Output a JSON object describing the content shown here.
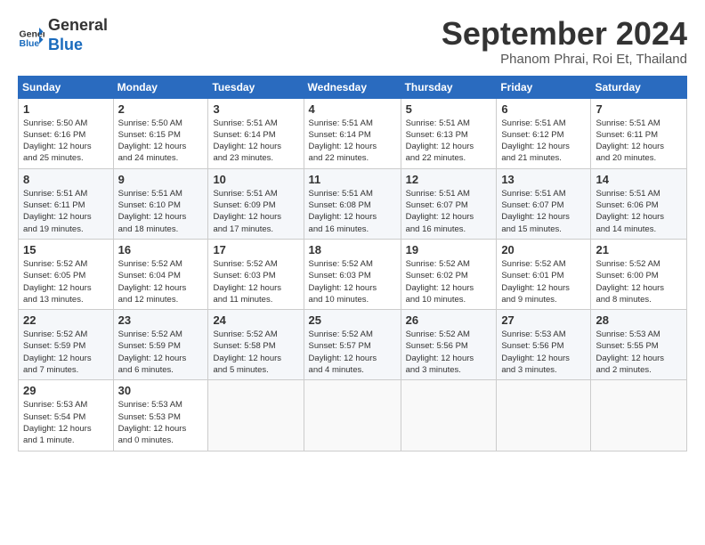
{
  "header": {
    "logo_line1": "General",
    "logo_line2": "Blue",
    "month_title": "September 2024",
    "location": "Phanom Phrai, Roi Et, Thailand"
  },
  "weekdays": [
    "Sunday",
    "Monday",
    "Tuesday",
    "Wednesday",
    "Thursday",
    "Friday",
    "Saturday"
  ],
  "weeks": [
    [
      {
        "day": "1",
        "info": "Sunrise: 5:50 AM\nSunset: 6:16 PM\nDaylight: 12 hours\nand 25 minutes."
      },
      {
        "day": "2",
        "info": "Sunrise: 5:50 AM\nSunset: 6:15 PM\nDaylight: 12 hours\nand 24 minutes."
      },
      {
        "day": "3",
        "info": "Sunrise: 5:51 AM\nSunset: 6:14 PM\nDaylight: 12 hours\nand 23 minutes."
      },
      {
        "day": "4",
        "info": "Sunrise: 5:51 AM\nSunset: 6:14 PM\nDaylight: 12 hours\nand 22 minutes."
      },
      {
        "day": "5",
        "info": "Sunrise: 5:51 AM\nSunset: 6:13 PM\nDaylight: 12 hours\nand 22 minutes."
      },
      {
        "day": "6",
        "info": "Sunrise: 5:51 AM\nSunset: 6:12 PM\nDaylight: 12 hours\nand 21 minutes."
      },
      {
        "day": "7",
        "info": "Sunrise: 5:51 AM\nSunset: 6:11 PM\nDaylight: 12 hours\nand 20 minutes."
      }
    ],
    [
      {
        "day": "8",
        "info": "Sunrise: 5:51 AM\nSunset: 6:11 PM\nDaylight: 12 hours\nand 19 minutes."
      },
      {
        "day": "9",
        "info": "Sunrise: 5:51 AM\nSunset: 6:10 PM\nDaylight: 12 hours\nand 18 minutes."
      },
      {
        "day": "10",
        "info": "Sunrise: 5:51 AM\nSunset: 6:09 PM\nDaylight: 12 hours\nand 17 minutes."
      },
      {
        "day": "11",
        "info": "Sunrise: 5:51 AM\nSunset: 6:08 PM\nDaylight: 12 hours\nand 16 minutes."
      },
      {
        "day": "12",
        "info": "Sunrise: 5:51 AM\nSunset: 6:07 PM\nDaylight: 12 hours\nand 16 minutes."
      },
      {
        "day": "13",
        "info": "Sunrise: 5:51 AM\nSunset: 6:07 PM\nDaylight: 12 hours\nand 15 minutes."
      },
      {
        "day": "14",
        "info": "Sunrise: 5:51 AM\nSunset: 6:06 PM\nDaylight: 12 hours\nand 14 minutes."
      }
    ],
    [
      {
        "day": "15",
        "info": "Sunrise: 5:52 AM\nSunset: 6:05 PM\nDaylight: 12 hours\nand 13 minutes."
      },
      {
        "day": "16",
        "info": "Sunrise: 5:52 AM\nSunset: 6:04 PM\nDaylight: 12 hours\nand 12 minutes."
      },
      {
        "day": "17",
        "info": "Sunrise: 5:52 AM\nSunset: 6:03 PM\nDaylight: 12 hours\nand 11 minutes."
      },
      {
        "day": "18",
        "info": "Sunrise: 5:52 AM\nSunset: 6:03 PM\nDaylight: 12 hours\nand 10 minutes."
      },
      {
        "day": "19",
        "info": "Sunrise: 5:52 AM\nSunset: 6:02 PM\nDaylight: 12 hours\nand 10 minutes."
      },
      {
        "day": "20",
        "info": "Sunrise: 5:52 AM\nSunset: 6:01 PM\nDaylight: 12 hours\nand 9 minutes."
      },
      {
        "day": "21",
        "info": "Sunrise: 5:52 AM\nSunset: 6:00 PM\nDaylight: 12 hours\nand 8 minutes."
      }
    ],
    [
      {
        "day": "22",
        "info": "Sunrise: 5:52 AM\nSunset: 5:59 PM\nDaylight: 12 hours\nand 7 minutes."
      },
      {
        "day": "23",
        "info": "Sunrise: 5:52 AM\nSunset: 5:59 PM\nDaylight: 12 hours\nand 6 minutes."
      },
      {
        "day": "24",
        "info": "Sunrise: 5:52 AM\nSunset: 5:58 PM\nDaylight: 12 hours\nand 5 minutes."
      },
      {
        "day": "25",
        "info": "Sunrise: 5:52 AM\nSunset: 5:57 PM\nDaylight: 12 hours\nand 4 minutes."
      },
      {
        "day": "26",
        "info": "Sunrise: 5:52 AM\nSunset: 5:56 PM\nDaylight: 12 hours\nand 3 minutes."
      },
      {
        "day": "27",
        "info": "Sunrise: 5:53 AM\nSunset: 5:56 PM\nDaylight: 12 hours\nand 3 minutes."
      },
      {
        "day": "28",
        "info": "Sunrise: 5:53 AM\nSunset: 5:55 PM\nDaylight: 12 hours\nand 2 minutes."
      }
    ],
    [
      {
        "day": "29",
        "info": "Sunrise: 5:53 AM\nSunset: 5:54 PM\nDaylight: 12 hours\nand 1 minute."
      },
      {
        "day": "30",
        "info": "Sunrise: 5:53 AM\nSunset: 5:53 PM\nDaylight: 12 hours\nand 0 minutes."
      },
      {
        "day": "",
        "info": ""
      },
      {
        "day": "",
        "info": ""
      },
      {
        "day": "",
        "info": ""
      },
      {
        "day": "",
        "info": ""
      },
      {
        "day": "",
        "info": ""
      }
    ]
  ]
}
